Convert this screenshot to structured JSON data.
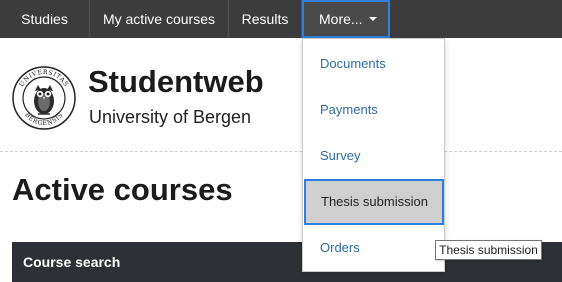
{
  "nav": {
    "items": [
      {
        "label": "Studies"
      },
      {
        "label": "My active courses"
      },
      {
        "label": "Results"
      },
      {
        "label": "More..."
      }
    ],
    "bg_color": "#3c3c3c",
    "focus_color": "#2f7fe0"
  },
  "brand": {
    "title": "Studentweb",
    "subtitle": "University of Bergen",
    "logo_icon": "university-seal-icon",
    "seal_text": "UNIVERSITAS BERGENSIS"
  },
  "page": {
    "title": "Active courses"
  },
  "panel": {
    "label": "Course search"
  },
  "dropdown": {
    "items": [
      {
        "label": "Documents"
      },
      {
        "label": "Payments"
      },
      {
        "label": "Survey"
      },
      {
        "label": "Thesis submission"
      },
      {
        "label": "Orders"
      }
    ],
    "selected": "Thesis submission",
    "link_color": "#2e6da4"
  },
  "tooltip": {
    "text": "Thesis submission"
  }
}
